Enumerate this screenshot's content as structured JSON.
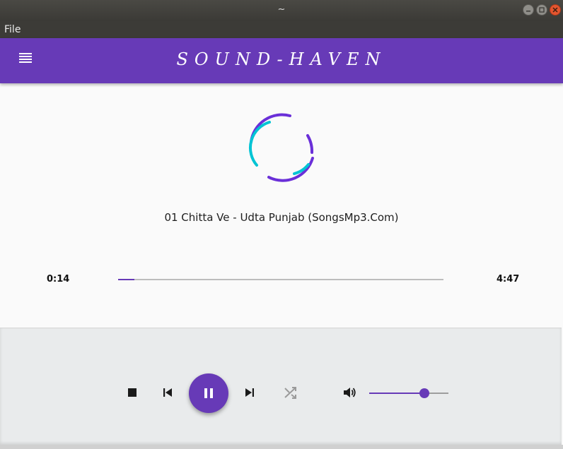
{
  "window": {
    "title": "~"
  },
  "menubar": {
    "items": [
      "File"
    ]
  },
  "appbar": {
    "title": "SOUND-HAVEN"
  },
  "now_playing": {
    "title": "01 Chitta Ve - Udta Punjab (SongsMp3.Com)",
    "elapsed": "0:14",
    "duration": "4:47",
    "progress_fraction": 0.049
  },
  "controls": {
    "icons": [
      "stop-icon",
      "skip-previous-icon",
      "pause-icon",
      "skip-next-icon",
      "shuffle-icon",
      "volume-icon"
    ],
    "volume_fraction": 0.7
  },
  "colors": {
    "primary": "#673ab7",
    "accent": "#00c4d4"
  }
}
